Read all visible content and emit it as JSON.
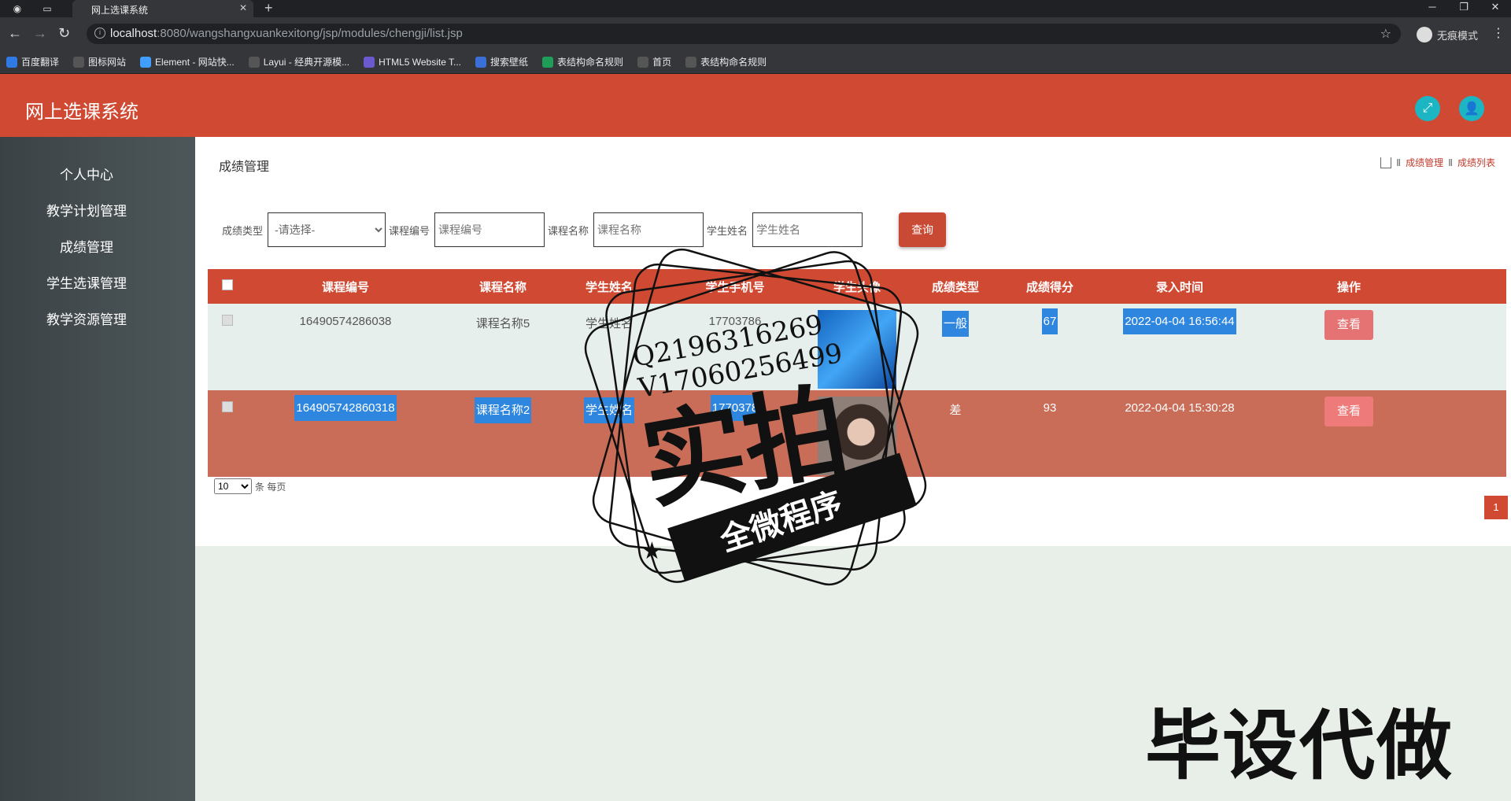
{
  "browser": {
    "tab_title": "网上选课系统",
    "url_host": "localhost",
    "url_rest": ":8080/wangshangxuankexitong/jsp/modules/chengji/list.jsp",
    "profile_label": "无痕模式",
    "bookmarks": [
      {
        "label": "百度翻译",
        "icon": "translate-icon",
        "color": "#2f7ae5"
      },
      {
        "label": "图标网站",
        "icon": "flag-icon",
        "color": "#555555"
      },
      {
        "label": "Element - 网站快...",
        "icon": "element-icon",
        "color": "#409eff"
      },
      {
        "label": "Layui - 经典开源模...",
        "icon": "layui-icon",
        "color": "#555555"
      },
      {
        "label": "HTML5 Website T...",
        "icon": "html5-icon",
        "color": "#6a5acd"
      },
      {
        "label": "搜索壁纸",
        "icon": "wallpaper-icon",
        "color": "#3b6fd8"
      },
      {
        "label": "表结构命名规则",
        "icon": "sheet-icon",
        "color": "#1e9e57"
      },
      {
        "label": "首页",
        "icon": "globe-icon",
        "color": "#555555"
      },
      {
        "label": "表结构命名规则",
        "icon": "globe-icon",
        "color": "#555555"
      }
    ]
  },
  "header": {
    "title": "网上选课系统"
  },
  "sidebar": {
    "items": [
      {
        "label": "个人中心"
      },
      {
        "label": "教学计划管理"
      },
      {
        "label": "成绩管理"
      },
      {
        "label": "学生选课管理"
      },
      {
        "label": "教学资源管理"
      }
    ]
  },
  "page": {
    "heading": "成绩管理",
    "breadcrumb": [
      "成绩管理",
      "成绩列表"
    ]
  },
  "filters": {
    "type_label": "成绩类型",
    "type_selected": "-请选择-",
    "code_label": "课程编号",
    "code_placeholder": "课程编号",
    "name_label": "课程名称",
    "name_placeholder": "课程名称",
    "student_label": "学生姓名",
    "student_placeholder": "学生姓名",
    "search_label": "查询"
  },
  "table": {
    "headers": [
      "课程编号",
      "课程名称",
      "学生姓名",
      "学生手机号",
      "学生头像",
      "成绩类型",
      "成绩得分",
      "录入时间",
      "操作"
    ],
    "rows": [
      {
        "code": "16490574286038",
        "name": "课程名称5",
        "student": "学生姓名",
        "phone": "17703786",
        "type": "一般",
        "score": "67",
        "time": "2022-04-04 16:56:44",
        "action": "查看"
      },
      {
        "code": "164905742860318",
        "name": "课程名称2",
        "student": "学生姓名",
        "phone": "1770378",
        "type": "差",
        "score": "93",
        "time": "2022-04-04 15:30:28",
        "action": "查看"
      }
    ]
  },
  "pager": {
    "page_size": "10",
    "per_page_label": "条 每页",
    "current_page": "1"
  },
  "watermark": {
    "contact_q": "Q2196316269",
    "contact_v": "V17060256499",
    "stamp_big": "实拍",
    "stamp_banner": "全微程序",
    "corner_text": "毕设代做"
  },
  "colors": {
    "accent": "#d04a33",
    "teal": "#1bb5c4",
    "select_blue": "#2e86de"
  }
}
